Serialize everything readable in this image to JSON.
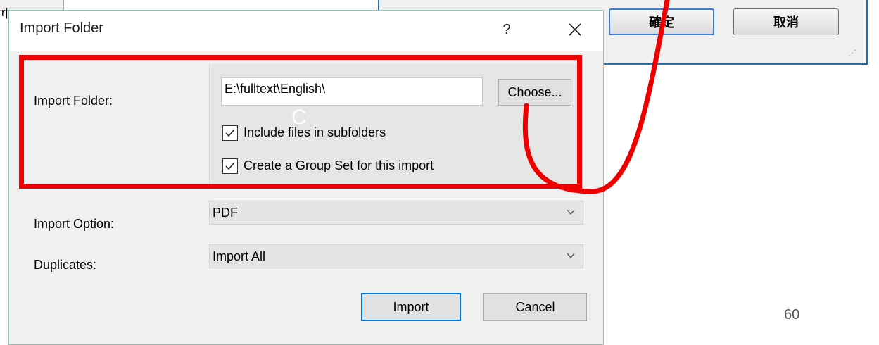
{
  "background": {
    "left_window_text": "r|",
    "ok_button": "確定",
    "cancel_button": "取消"
  },
  "dialog": {
    "title": "Import Folder",
    "help_symbol": "?",
    "import_folder_label": "Import Folder:",
    "path_value": "E:\\fulltext\\English\\",
    "choose_button": "Choose...",
    "include_subfolders_label": "Include files in subfolders",
    "include_subfolders_checked": true,
    "group_set_label": "Create a Group Set for this import",
    "group_set_checked": true,
    "import_option_label": "Import Option:",
    "import_option_value": "PDF",
    "duplicates_label": "Duplicates:",
    "duplicates_value": "Import All",
    "import_button": "Import",
    "cancel_button": "Cancel"
  },
  "slide": {
    "page_number": "60",
    "cursor_glyph": "C"
  },
  "colors": {
    "annotation_red": "#ee0000",
    "focus_blue": "#0078d7",
    "dialog_border": "#8ec5b8"
  },
  "icons": [
    "close-icon",
    "checkmark-icon",
    "chevron-down-icon",
    "resize-grip-icon"
  ]
}
